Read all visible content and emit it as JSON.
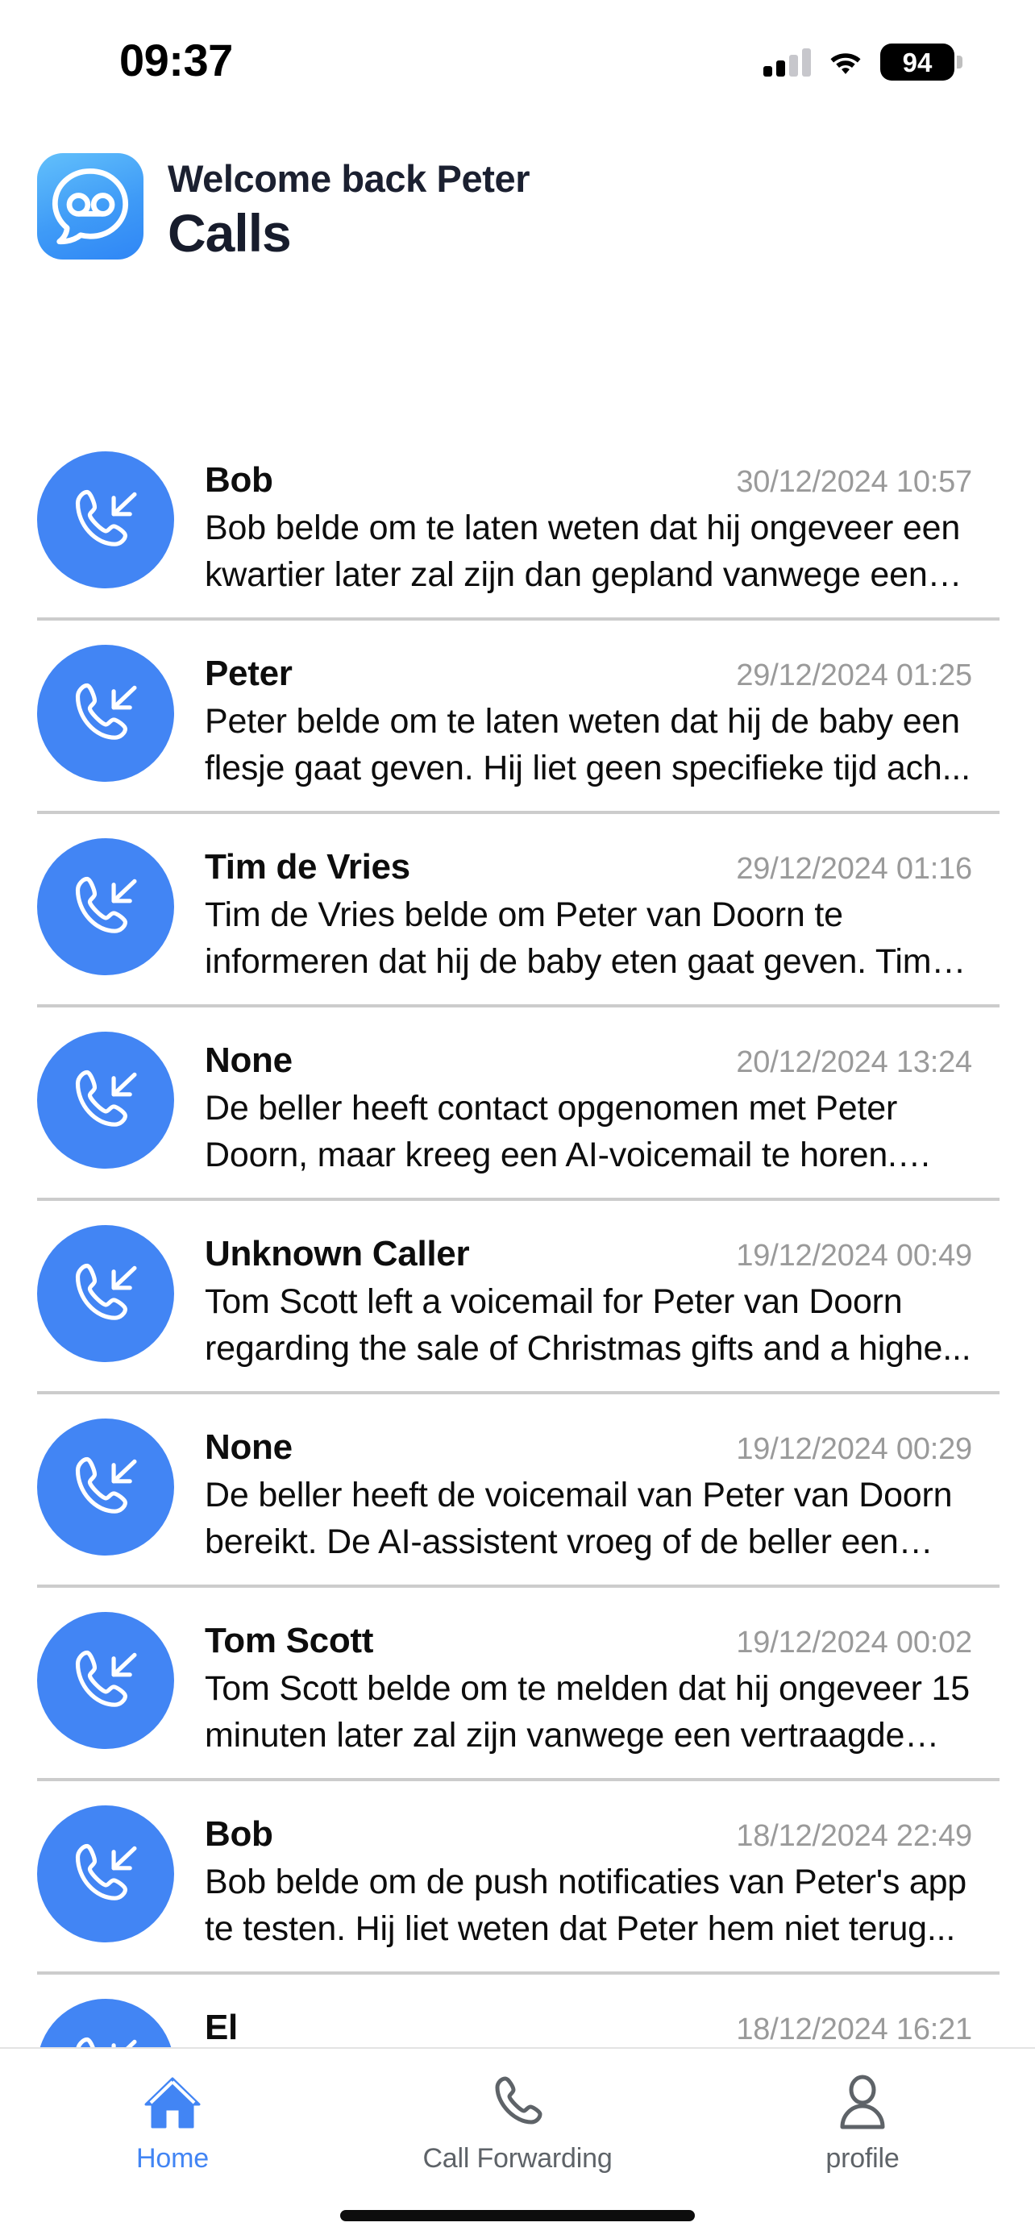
{
  "status_bar": {
    "time": "09:37",
    "signal_icon": "cellular-signal-icon",
    "wifi_icon": "wifi-icon",
    "battery_icon": "battery-icon",
    "battery_percent": "94"
  },
  "header": {
    "logo_icon": "voicemail-app-logo-icon",
    "welcome": "Welcome back Peter",
    "title": "Calls",
    "accent_color": "#4285f4",
    "title_color": "#171c2c"
  },
  "calls": [
    {
      "icon": "incoming-call-icon",
      "caller": "Bob",
      "timestamp": "30/12/2024 10:57",
      "summary": "Bob belde om te laten weten dat hij ongeveer een kwartier later zal zijn dan gepland vanwege een v..."
    },
    {
      "icon": "incoming-call-icon",
      "caller": "Peter",
      "timestamp": "29/12/2024 01:25",
      "summary": "Peter belde om te laten weten dat hij de baby een flesje gaat geven. Hij liet geen specifieke tijd ach..."
    },
    {
      "icon": "incoming-call-icon",
      "caller": "Tim de Vries",
      "timestamp": "29/12/2024 01:16",
      "summary": "Tim de Vries belde om Peter van Doorn te informeren dat hij de baby eten gaat geven. Tim l..."
    },
    {
      "icon": "incoming-call-icon",
      "caller": "None",
      "timestamp": "20/12/2024 13:24",
      "summary": "De beller heeft contact opgenomen met Peter Doorn, maar kreeg een AI-voicemail te horen. De..."
    },
    {
      "icon": "incoming-call-icon",
      "caller": "Unknown Caller",
      "timestamp": "19/12/2024 00:49",
      "summary": "Tom Scott left a voicemail for Peter van Doorn regarding the sale of Christmas gifts and a highe..."
    },
    {
      "icon": "incoming-call-icon",
      "caller": "None",
      "timestamp": "19/12/2024 00:29",
      "summary": "De beller heeft de voicemail van Peter van Doorn bereikt. De AI-assistent vroeg of de beller een be..."
    },
    {
      "icon": "incoming-call-icon",
      "caller": "Tom Scott",
      "timestamp": "19/12/2024 00:02",
      "summary": "Tom Scott belde om te melden dat hij ongeveer 15 minuten later zal zijn vanwege een vertraagde tre..."
    },
    {
      "icon": "incoming-call-icon",
      "caller": "Bob",
      "timestamp": "18/12/2024 22:49",
      "summary": "Bob belde om de push notificaties van Peter's app te testen. Hij liet weten dat Peter hem niet terug..."
    },
    {
      "icon": "incoming-call-icon",
      "caller": "El",
      "timestamp": "18/12/2024 16:21",
      "summary": ""
    }
  ],
  "tabbar": {
    "items": [
      {
        "icon": "home-icon",
        "label": "Home",
        "active": true
      },
      {
        "icon": "phone-forward-icon",
        "label": "Call Forwarding",
        "active": false
      },
      {
        "icon": "person-icon",
        "label": "profile",
        "active": false
      }
    ],
    "active_color": "#4285f4",
    "inactive_color": "#5e6368"
  }
}
